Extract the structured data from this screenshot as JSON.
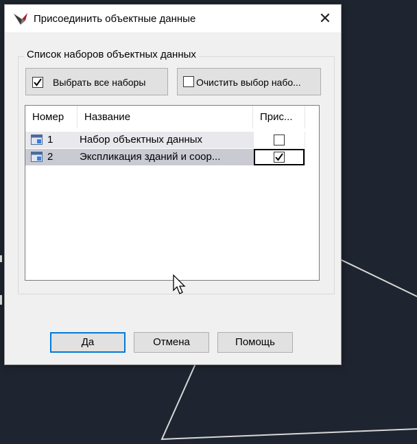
{
  "window": {
    "title": "Присоединить объектные данные",
    "close_glyph": "✕"
  },
  "group": {
    "label": "Список наборов объектных данных",
    "select_all_label": "Выбрать все наборы",
    "select_all_checked": true,
    "clear_label": "Очистить выбор набо..."
  },
  "list": {
    "columns": [
      "Номер",
      "Название",
      "Прис..."
    ],
    "rows": [
      {
        "number": "1",
        "name": "Набор объектных данных",
        "checked": false
      },
      {
        "number": "2",
        "name": "Экспликация зданий и соор...",
        "checked": true
      }
    ]
  },
  "buttons": {
    "ok": "Да",
    "cancel": "Отмена",
    "help": "Помощь"
  },
  "icons": {
    "app": "autocad-map-icon",
    "row": "table-icon",
    "check": "checkmark-icon"
  },
  "colors": {
    "desktop": "#1f2530",
    "dialog": "#f0f0f0",
    "focus": "#0078d7",
    "selected_row": "#c9cad2"
  }
}
